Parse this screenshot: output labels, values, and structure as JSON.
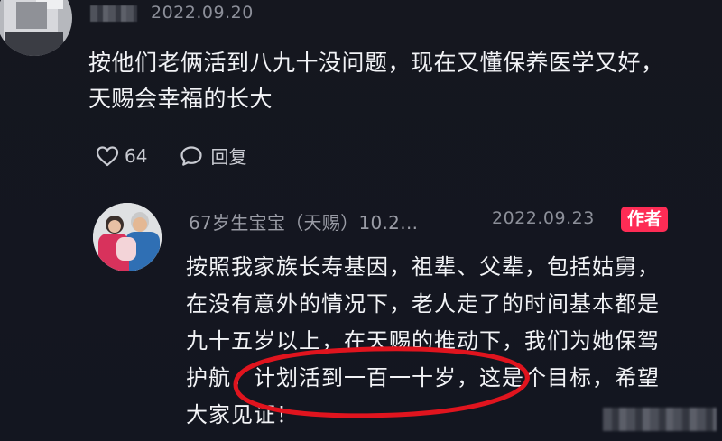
{
  "top_comment": {
    "date": "2022.09.20",
    "text_lines": [
      "按他们老俩活到八九十没问题，现在又懂保养医学又好，",
      "天赐会幸福的长大"
    ],
    "like_count": "64",
    "reply_label": "回复"
  },
  "author_reply": {
    "username": "67岁生宝宝（天赐）10.2…",
    "date": "2022.09.23",
    "author_badge": "作者",
    "text_lines": [
      "按照我家族长寿基因，祖辈、父辈，包括姑舅，",
      "在没有意外的情况下，老人走了的时间基本都是",
      "九十五岁以上，在天赐的推动下，我们为她保驾",
      "护航，计划活到一百一十岁，这是个目标，希望",
      "大家见证！"
    ]
  },
  "colors": {
    "background": "#141720",
    "author_badge": "#fe2c55",
    "annotation": "#e0141e"
  }
}
